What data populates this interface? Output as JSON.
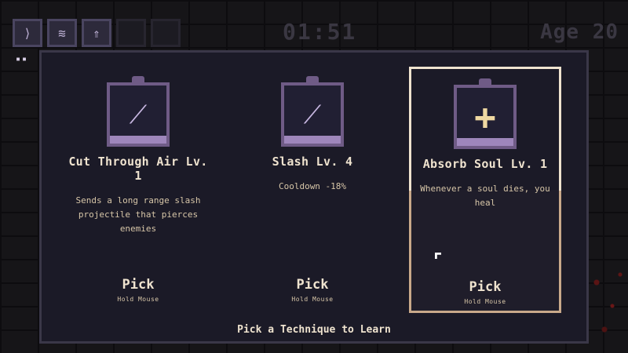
{
  "hud": {
    "slots": [
      {
        "icon": "slash-skill-icon",
        "glyph": "⟩"
      },
      {
        "icon": "wing-skill-icon",
        "glyph": "≋"
      },
      {
        "icon": "arrow-up-skill-icon",
        "glyph": "⇑"
      },
      {
        "icon": "empty-slot",
        "glyph": ""
      },
      {
        "icon": "empty-slot",
        "glyph": ""
      }
    ],
    "dots": "▪▪",
    "timer": "01:51",
    "age": "Age 20"
  },
  "choices": [
    {
      "name": "Cut Through Air Lv. 1",
      "description": "Sends a long range slash projectile that pierces enemies",
      "icon": "slash-projectile-icon",
      "glyph": "⟋",
      "pick_label": "Pick",
      "hold_label": "Hold Mouse",
      "selected": false
    },
    {
      "name": "Slash Lv. 4",
      "description": "Cooldown -18%",
      "icon": "slash-icon",
      "glyph": "⟋",
      "pick_label": "Pick",
      "hold_label": "Hold Mouse",
      "selected": false
    },
    {
      "name": "Absorb Soul Lv. 1",
      "description": "Whenever a soul dies, you heal",
      "icon": "heal-cross-icon",
      "glyph": "+",
      "pick_label": "Pick",
      "hold_label": "Hold Mouse",
      "selected": true
    }
  ],
  "footer": "Pick a Technique to Learn",
  "colors": {
    "panel": "#1b1a27",
    "icon_frame": "#6f5b86",
    "text": "#efe3cf",
    "selected_border": "#efe3cf"
  }
}
